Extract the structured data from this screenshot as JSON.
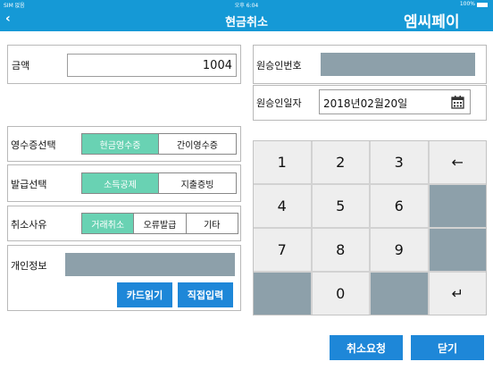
{
  "status_bar": {
    "carrier": "SIM 없음",
    "time": "오후 6:04",
    "battery": "100%"
  },
  "header": {
    "title": "현금취소",
    "back_icon": "chevron-left-icon",
    "logo_text": "엠씨페이"
  },
  "amount": {
    "label": "금액",
    "value": "1004"
  },
  "approval_number": {
    "label": "원승인번호",
    "value": ""
  },
  "approval_date": {
    "label": "원승인일자",
    "value": "2018년02월20일",
    "icon": "calendar-icon"
  },
  "receipt_type": {
    "label": "영수증선택",
    "options": [
      "현금영수증",
      "간이영수증"
    ],
    "selected": 0
  },
  "issue_type": {
    "label": "발급선택",
    "options": [
      "소득공제",
      "지출증빙"
    ],
    "selected": 0
  },
  "cancel_reason": {
    "label": "취소사유",
    "options": [
      "거래취소",
      "오류발급",
      "기타"
    ],
    "selected": 0
  },
  "personal_info": {
    "label": "개인정보",
    "value": "",
    "card_read_label": "카드읽기",
    "direct_input_label": "직접입력"
  },
  "keypad": {
    "keys": [
      "1",
      "2",
      "3",
      "←",
      "4",
      "5",
      "6",
      "",
      "7",
      "8",
      "9",
      "",
      "",
      "0",
      "",
      "↵"
    ]
  },
  "footer": {
    "cancel_request_label": "취소요청",
    "close_label": "닫기"
  },
  "colors": {
    "brand": "#1599d6",
    "selected": "#69d2b3",
    "button": "#1e87d8",
    "gray_field": "#8da0aa"
  }
}
